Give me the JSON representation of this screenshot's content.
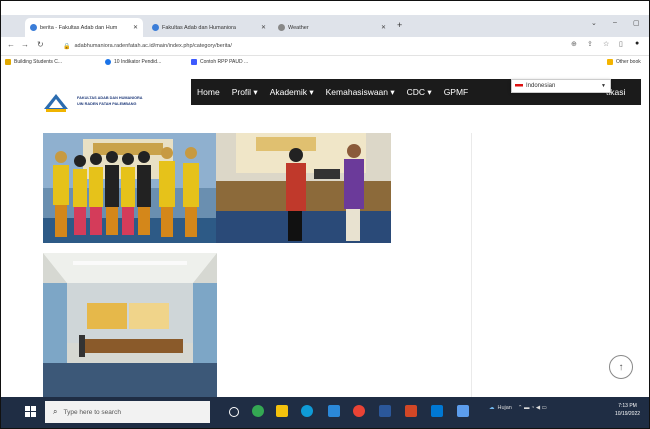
{
  "browser": {
    "tabs": [
      {
        "label": "berita - Fakultas Adab dan Hum",
        "active": true,
        "icon_color": "#3b7dd8"
      },
      {
        "label": "Fakultas Adab dan Humaniora",
        "active": false,
        "icon_color": "#3b7dd8"
      },
      {
        "label": "Weather",
        "active": false,
        "icon_color": "#888888"
      }
    ],
    "new_tab_label": "+",
    "url": "adabhumaniora.radenfatah.ac.id/main/index.php/category/berita/",
    "bookmarks": [
      {
        "label": "Building Students C...",
        "icon_color": "#e0a800"
      },
      {
        "label": "10 Indikator Pendid...",
        "icon_color": "#1a73e8"
      },
      {
        "label": "Contoh RPP PAUD ...",
        "icon_color": "#3d5afe"
      },
      {
        "label": "Other book",
        "icon_color": "#f4b400"
      }
    ]
  },
  "site": {
    "logo_text_line1": "FAKULTAS ADAB DAN HUMANIORA",
    "logo_text_line2": "UIN RADEN FATAH PALEMBANG",
    "nav_items": [
      "Home",
      "Profil ▾",
      "Akademik ▾",
      "Kemahasiswaan ▾",
      "CDC ▾",
      "GPMF"
    ],
    "nav_tail": "tikasi",
    "language": {
      "selected": "Indonesian",
      "flag": "indonesia-flag"
    },
    "scroll_top_icon": "↑"
  },
  "taskbar": {
    "search_placeholder": "Type here to search",
    "icons": [
      {
        "name": "task-view-icon",
        "color": "#ffffff"
      },
      {
        "name": "chrome-icon",
        "color": "#34a853"
      },
      {
        "name": "file-explorer-icon",
        "color": "#f4c20d"
      },
      {
        "name": "edge-icon",
        "color": "#0f9bd7"
      },
      {
        "name": "store-icon",
        "color": "#2b88d8"
      },
      {
        "name": "chrome-alt-icon",
        "color": "#ea4335"
      },
      {
        "name": "word-icon",
        "color": "#2b579a"
      },
      {
        "name": "powerpoint-icon",
        "color": "#d24726"
      },
      {
        "name": "mail-icon",
        "color": "#0078d4"
      },
      {
        "name": "photos-icon",
        "color": "#5c9ded"
      }
    ],
    "tray_text": "Hujan",
    "time": "7:13 PM",
    "date": "10/19/2022"
  },
  "colors": {
    "navbar": "#1b1b1b",
    "taskbar": "#1f2d44",
    "brand_blue": "#1f3a7a"
  }
}
